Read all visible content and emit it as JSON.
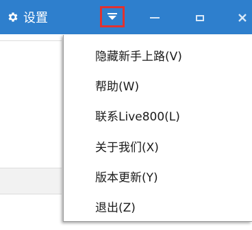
{
  "title_bar": {
    "settings_label": "设置",
    "settings_icon": "gear-icon",
    "dropdown_icon": "menu-dropdown-icon",
    "minimize_icon": "minimize-icon",
    "maximize_icon": "maximize-icon",
    "close_icon": "close-icon",
    "background_color": "#2e7fcd",
    "highlight_color": "#e2312f"
  },
  "menu": {
    "items": [
      {
        "label": "隐藏新手上路(V)"
      },
      {
        "label": "帮助(W)"
      },
      {
        "label": "联系Live800(L)"
      },
      {
        "label": "关于我们(X)"
      },
      {
        "label": "版本更新(Y)"
      },
      {
        "label": "退出(Z)"
      }
    ]
  }
}
